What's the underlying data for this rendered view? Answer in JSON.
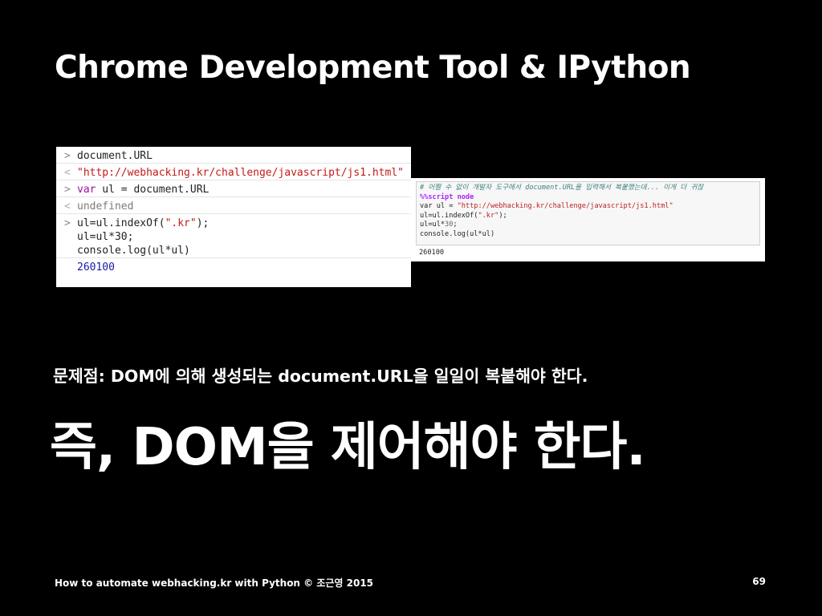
{
  "slide": {
    "title": "Chrome Development Tool & IPython",
    "problem_text": "문제점: DOM에 의해 생성되는 document.URL을 일일이 복붙해야 한다.",
    "emphasis_text": "즉, DOM을 제어해야 한다.",
    "footer": "How to automate webhacking.kr with Python © 조근영 2015",
    "page_number": "69"
  },
  "console": {
    "lines": [
      {
        "prefix": ">",
        "code": "document.URL"
      },
      {
        "prefix": "<",
        "code": "\"http://webhacking.kr/challenge/javascript/js1.html\""
      },
      {
        "prefix": ">",
        "kw": "var",
        "code": " ul = document.URL"
      },
      {
        "prefix": "<",
        "code": "undefined"
      },
      {
        "prefix": ">",
        "code_a": "ul=ul.indexOf(",
        "str": "\".kr\"",
        "code_b": ");"
      },
      {
        "prefix": "",
        "code": "ul=ul*30;"
      },
      {
        "prefix": "",
        "code": "console.log(ul*ul)"
      },
      {
        "prefix": "",
        "code": "260100"
      }
    ]
  },
  "ipython": {
    "comment": "# 어쩔 수 없이 개발자 도구에서 document.URL을 입력해서 복붙했는데... 이게 더 귀찮",
    "magic": "%%script node",
    "line3_a": "var ul = ",
    "line3_str": "\"http://webhacking.kr/challenge/javascript/js1.html\"",
    "line4_a": "ul=ul.indexOf(",
    "line4_str": "\".kr\"",
    "line4_b": ");",
    "line5_a": "ul=ul*",
    "line5_num": "30",
    "line5_b": ";",
    "line6": "console.log(ul*ul)",
    "output": "260100"
  }
}
